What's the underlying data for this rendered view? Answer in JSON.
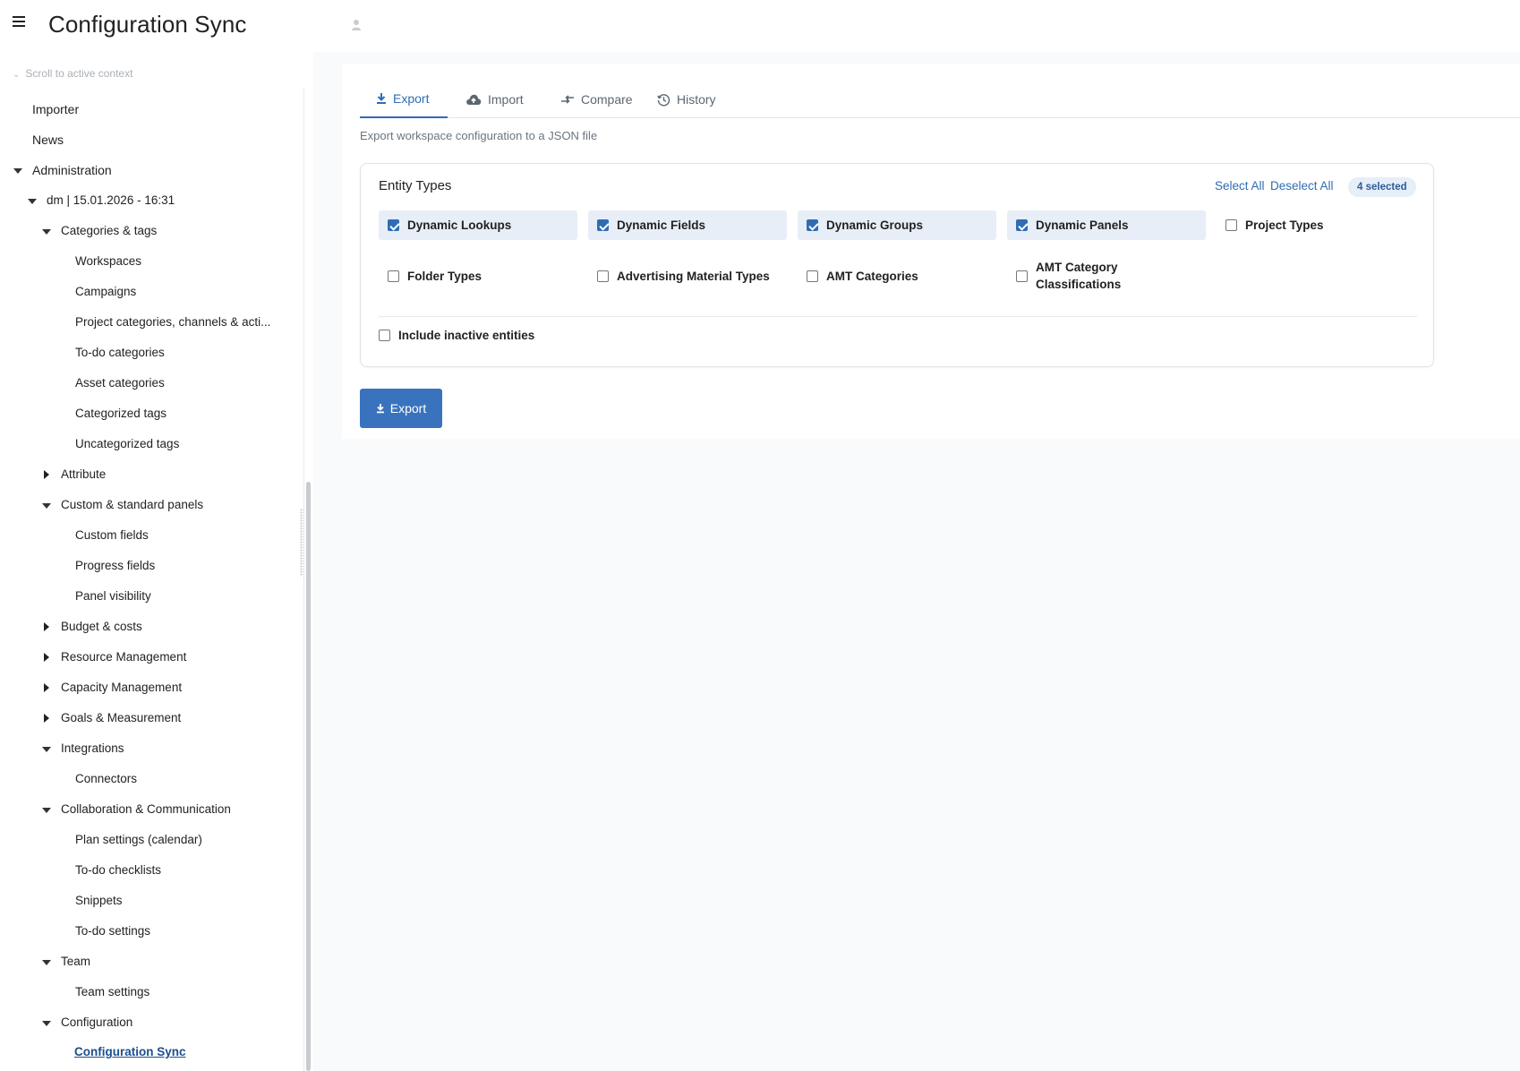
{
  "header": {
    "title": "Configuration Sync"
  },
  "sidebar": {
    "scroll_to_active": "Scroll to active context",
    "items": {
      "importer": "Importer",
      "news": "News",
      "administration": "Administration",
      "dm": "dm | 15.01.2026 - 16:31",
      "categories_tags": "Categories & tags",
      "workspaces": "Workspaces",
      "campaigns": "Campaigns",
      "project_categories": "Project categories, channels & acti...",
      "todo_categories": "To-do categories",
      "asset_categories": "Asset categories",
      "categorized_tags": "Categorized tags",
      "uncategorized_tags": "Uncategorized tags",
      "attribute": "Attribute",
      "custom_standard_panels": "Custom & standard panels",
      "custom_fields": "Custom fields",
      "progress_fields": "Progress fields",
      "panel_visibility": "Panel visibility",
      "budget_costs": "Budget & costs",
      "resource_management": "Resource Management",
      "capacity_management": "Capacity Management",
      "goals_measurement": "Goals & Measurement",
      "integrations": "Integrations",
      "connectors": "Connectors",
      "collaboration": "Collaboration & Communication",
      "plan_settings": "Plan settings (calendar)",
      "todo_checklists": "To-do checklists",
      "snippets": "Snippets",
      "todo_settings": "To-do settings",
      "team": "Team",
      "team_settings": "Team settings",
      "configuration": "Configuration",
      "configuration_sync": "Configuration Sync"
    }
  },
  "main": {
    "tabs": {
      "export": "Export",
      "import": "Import",
      "compare": "Compare",
      "history": "History"
    },
    "active_tab": "Export",
    "description": "Export workspace configuration to a JSON file",
    "entity_types": {
      "title": "Entity Types",
      "select_all": "Select All",
      "deselect_all": "Deselect All",
      "selected_count": "4 selected",
      "options": {
        "dynamic_lookups": "Dynamic Lookups",
        "dynamic_fields": "Dynamic Fields",
        "dynamic_groups": "Dynamic Groups",
        "dynamic_panels": "Dynamic Panels",
        "project_types": "Project Types",
        "folder_types": "Folder Types",
        "advertising_material_types": "Advertising Material Types",
        "amt_categories": "AMT Categories",
        "amt_category_classifications_1": "AMT Category",
        "amt_category_classifications_2": "Classifications"
      },
      "checked": [
        "Dynamic Lookups",
        "Dynamic Fields",
        "Dynamic Groups",
        "Dynamic Panels"
      ],
      "include_inactive": "Include inactive entities"
    },
    "export_button": "Export"
  },
  "colors": {
    "accent": "#2f6db3",
    "button": "#3a73bd",
    "checked_bg": "#e7eef7"
  },
  "icons": [
    "hamburger-icon",
    "user-icon",
    "download-icon",
    "cloud-upload-icon",
    "compare-icon",
    "history-icon",
    "caret-down-icon",
    "caret-right-icon"
  ]
}
